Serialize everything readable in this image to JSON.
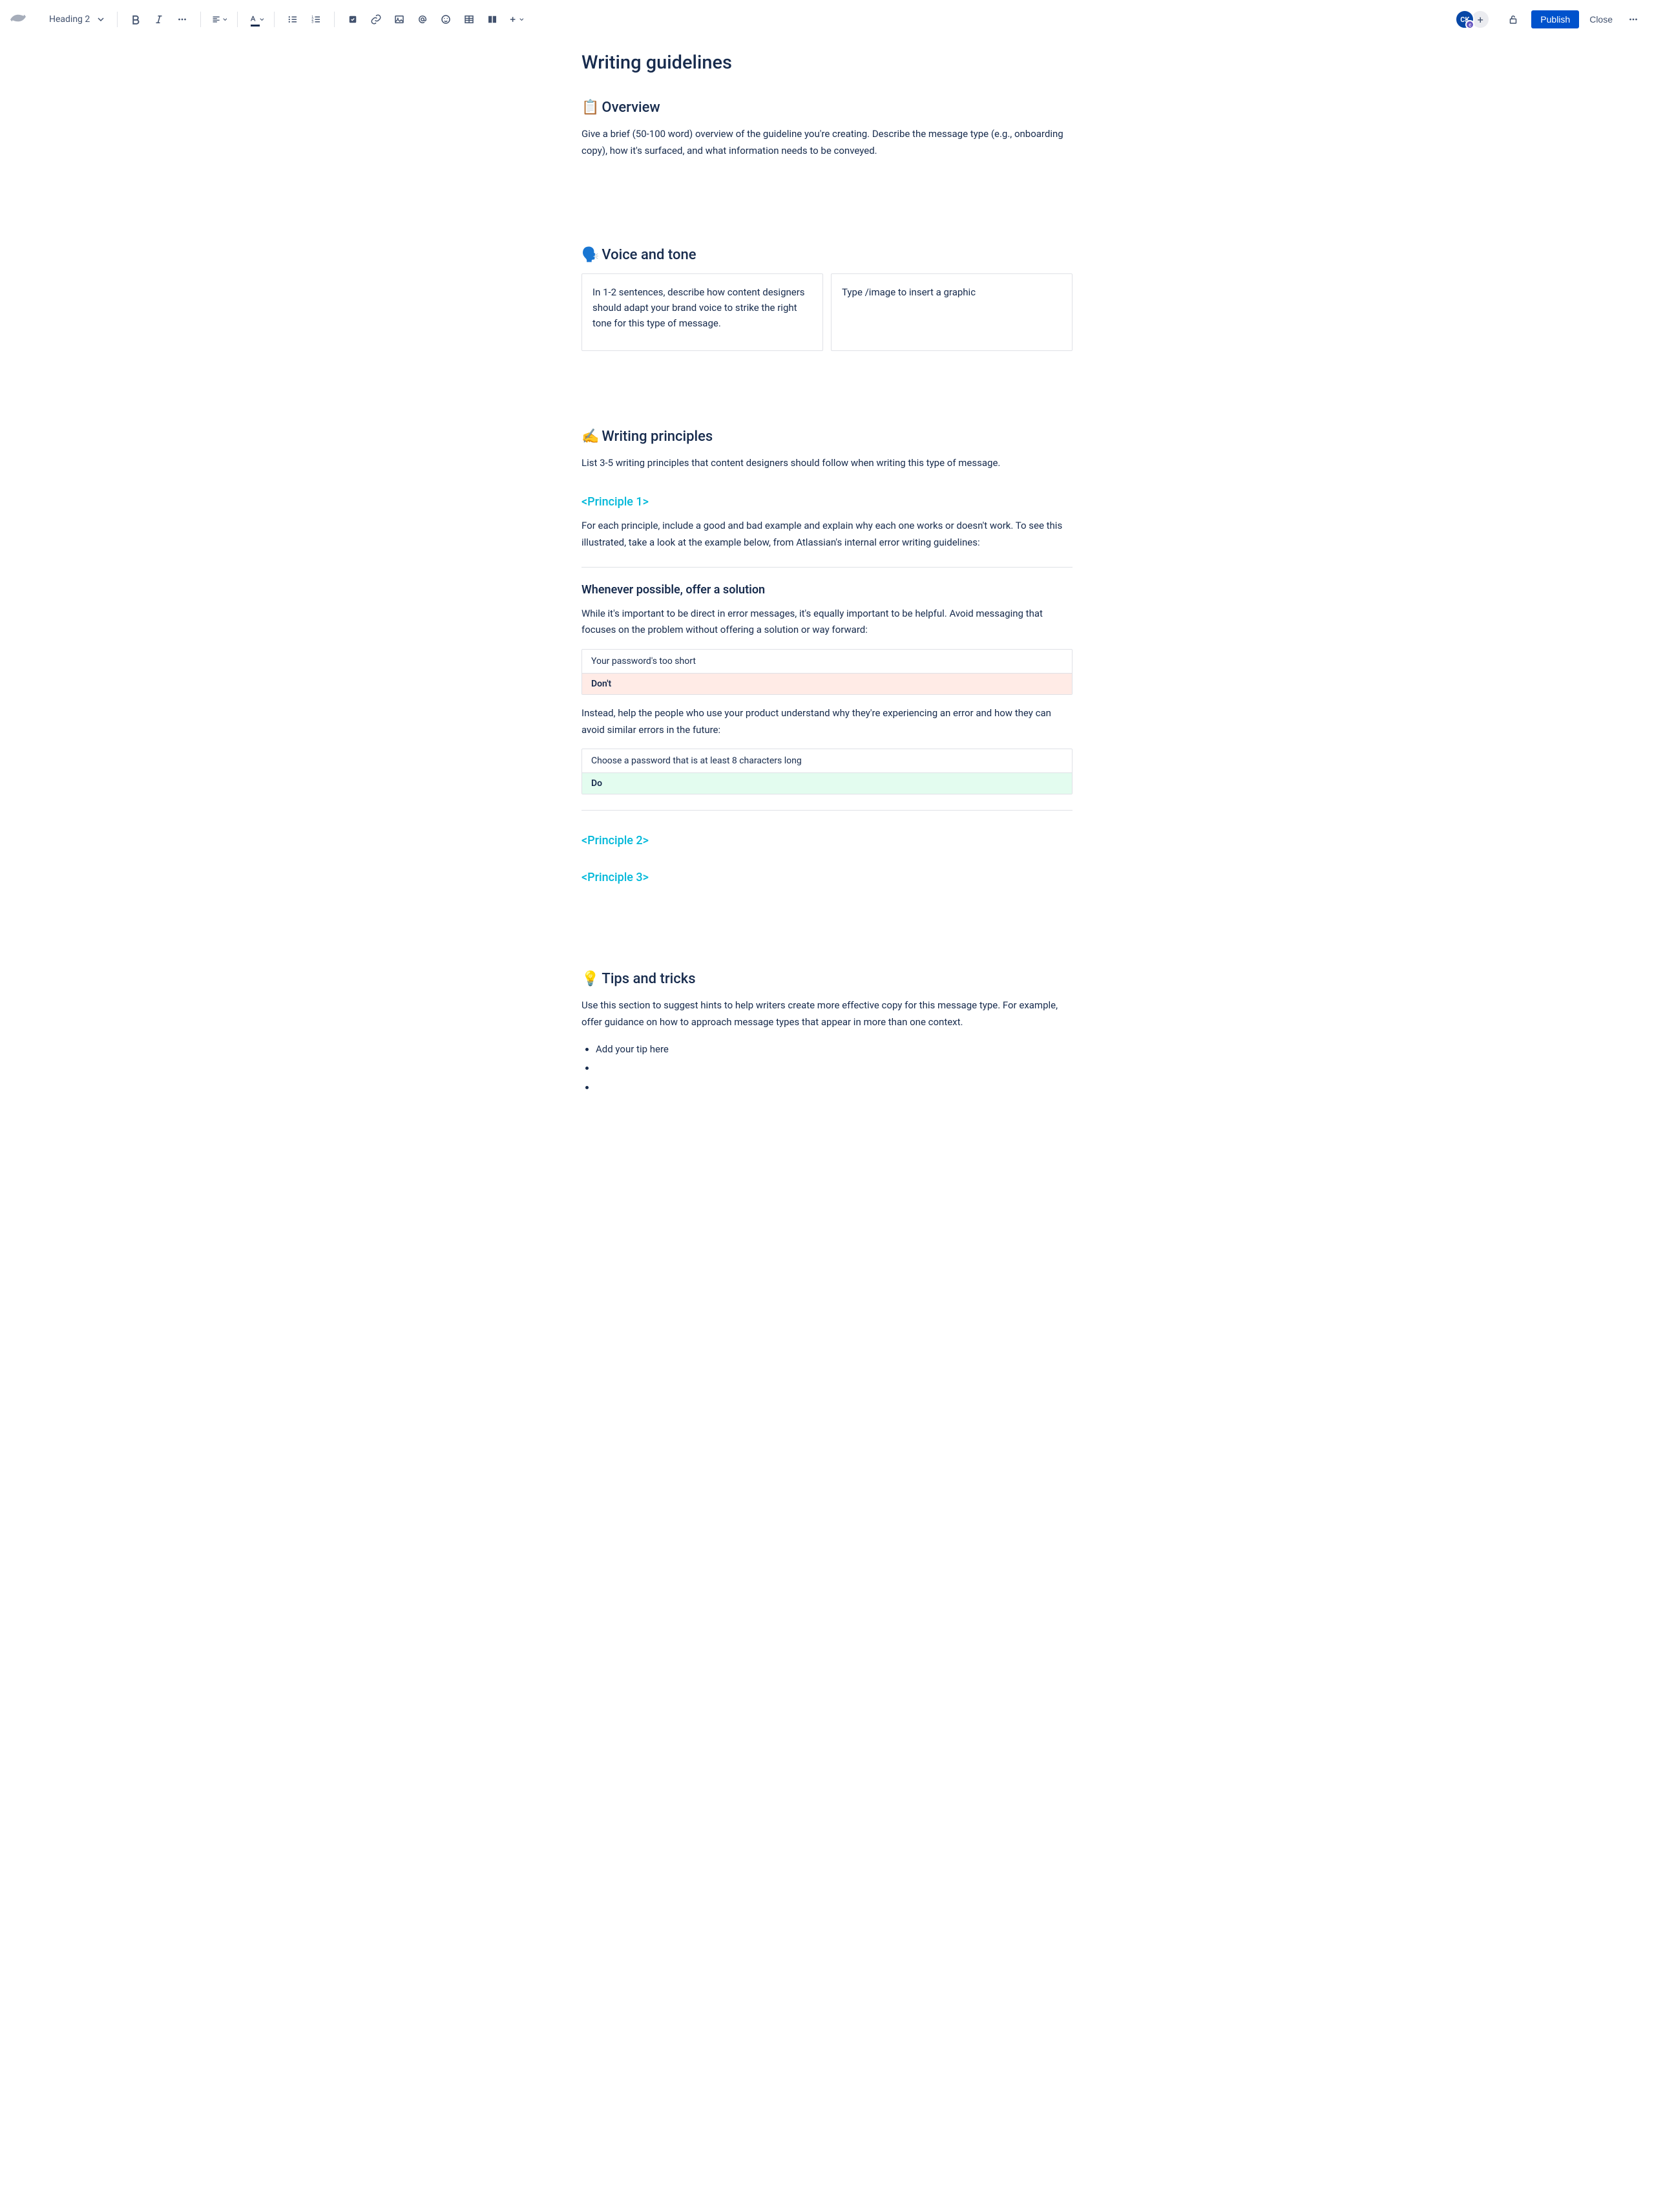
{
  "toolbar": {
    "heading_select": "Heading 2",
    "publish": "Publish",
    "close": "Close",
    "avatar_initials": "CK",
    "avatar_badge": "c"
  },
  "page": {
    "title": "Writing guidelines"
  },
  "overview": {
    "emoji": "📋",
    "heading": "Overview",
    "body": "Give a brief (50-100 word) overview of the guideline you're creating. Describe the message type (e.g., onboarding copy), how it's surfaced, and what information needs to be conveyed."
  },
  "voice": {
    "emoji": "🗣️",
    "heading": "Voice and tone",
    "left": "In 1-2 sentences, describe how content designers should adapt your brand voice to strike the right tone for this type of message.",
    "right": "Type /image to insert a graphic"
  },
  "principles": {
    "emoji": "✍️",
    "heading": "Writing principles",
    "intro": "List 3-5 writing principles that content designers should follow when writing this type of message.",
    "p1_title": "<Principle 1>",
    "p1_body": "For each principle, include a good and bad example and explain why each one works or doesn't work. To see this illustrated, take a look at the example below, from Atlassian's internal error writing guidelines:",
    "example_heading": "Whenever possible, offer a solution",
    "example_intro": "While it's important to be direct in error messages, it's equally important to be helpful. Avoid messaging that focuses on the problem without offering a solution or way forward:",
    "dont_text": "Your password's too short",
    "dont_label": "Don't",
    "do_intro": "Instead, help the people who use your product understand why they're experiencing an error and how they can avoid similar errors in the future:",
    "do_text": "Choose a password that is at least 8 characters long",
    "do_label": "Do",
    "p2_title": "<Principle 2>",
    "p3_title": "<Principle 3>"
  },
  "tips": {
    "emoji": "💡",
    "heading": "Tips and tricks",
    "intro": "Use this section to suggest hints to help writers create more effective copy for this message type. For example, offer guidance on how to approach message types that appear in more than one context.",
    "item1": "Add your tip here",
    "item2": "",
    "item3": ""
  }
}
